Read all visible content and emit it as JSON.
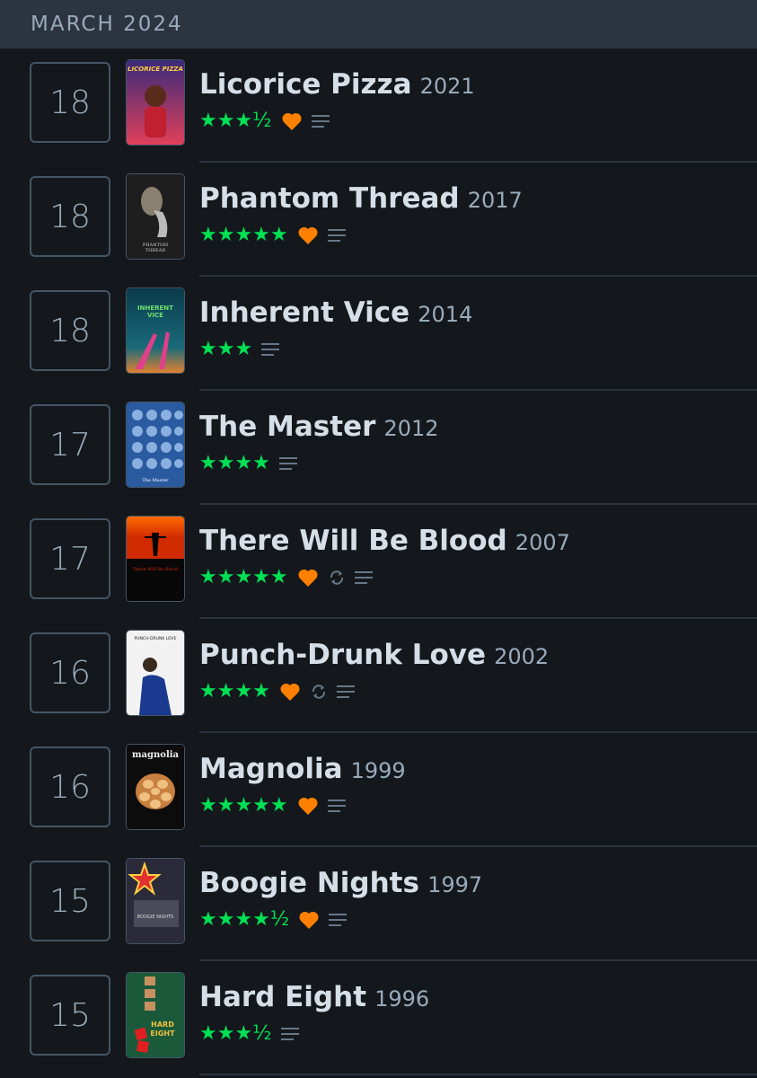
{
  "header": {
    "month": "MARCH 2024"
  },
  "entries": [
    {
      "day": "18",
      "title": "Licorice Pizza",
      "year": "2021",
      "stars": "★★★½",
      "liked": true,
      "rewatch": false,
      "review": true,
      "poster_label": "LICORICE PIZZA"
    },
    {
      "day": "18",
      "title": "Phantom Thread",
      "year": "2017",
      "stars": "★★★★★",
      "liked": true,
      "rewatch": false,
      "review": true,
      "poster_label": "PHANTOM THREAD"
    },
    {
      "day": "18",
      "title": "Inherent Vice",
      "year": "2014",
      "stars": "★★★",
      "liked": false,
      "rewatch": false,
      "review": true,
      "poster_label": "INHERENT VICE"
    },
    {
      "day": "17",
      "title": "The Master",
      "year": "2012",
      "stars": "★★★★",
      "liked": false,
      "rewatch": false,
      "review": true,
      "poster_label": "The Master"
    },
    {
      "day": "17",
      "title": "There Will Be Blood",
      "year": "2007",
      "stars": "★★★★★",
      "liked": true,
      "rewatch": true,
      "review": true,
      "poster_label": "There Will Be Blood"
    },
    {
      "day": "16",
      "title": "Punch-Drunk Love",
      "year": "2002",
      "stars": "★★★★",
      "liked": true,
      "rewatch": true,
      "review": true,
      "poster_label": "PUNCH-DRUNK LOVE"
    },
    {
      "day": "16",
      "title": "Magnolia",
      "year": "1999",
      "stars": "★★★★★",
      "liked": true,
      "rewatch": false,
      "review": true,
      "poster_label": "magnolia"
    },
    {
      "day": "15",
      "title": "Boogie Nights",
      "year": "1997",
      "stars": "★★★★½",
      "liked": true,
      "rewatch": false,
      "review": true,
      "poster_label": "BOOGIE NIGHTS"
    },
    {
      "day": "15",
      "title": "Hard Eight",
      "year": "1996",
      "stars": "★★★½",
      "liked": false,
      "rewatch": false,
      "review": true,
      "poster_label": "HARD EIGHT"
    }
  ],
  "colors": {
    "background": "#14181c",
    "header_bg": "#2c3440",
    "star": "#00e054",
    "heart": "#ff8000",
    "muted": "#9ab"
  },
  "icons": {
    "heart": "heart-icon",
    "rewatch": "rewatch-icon",
    "review": "review-icon"
  }
}
